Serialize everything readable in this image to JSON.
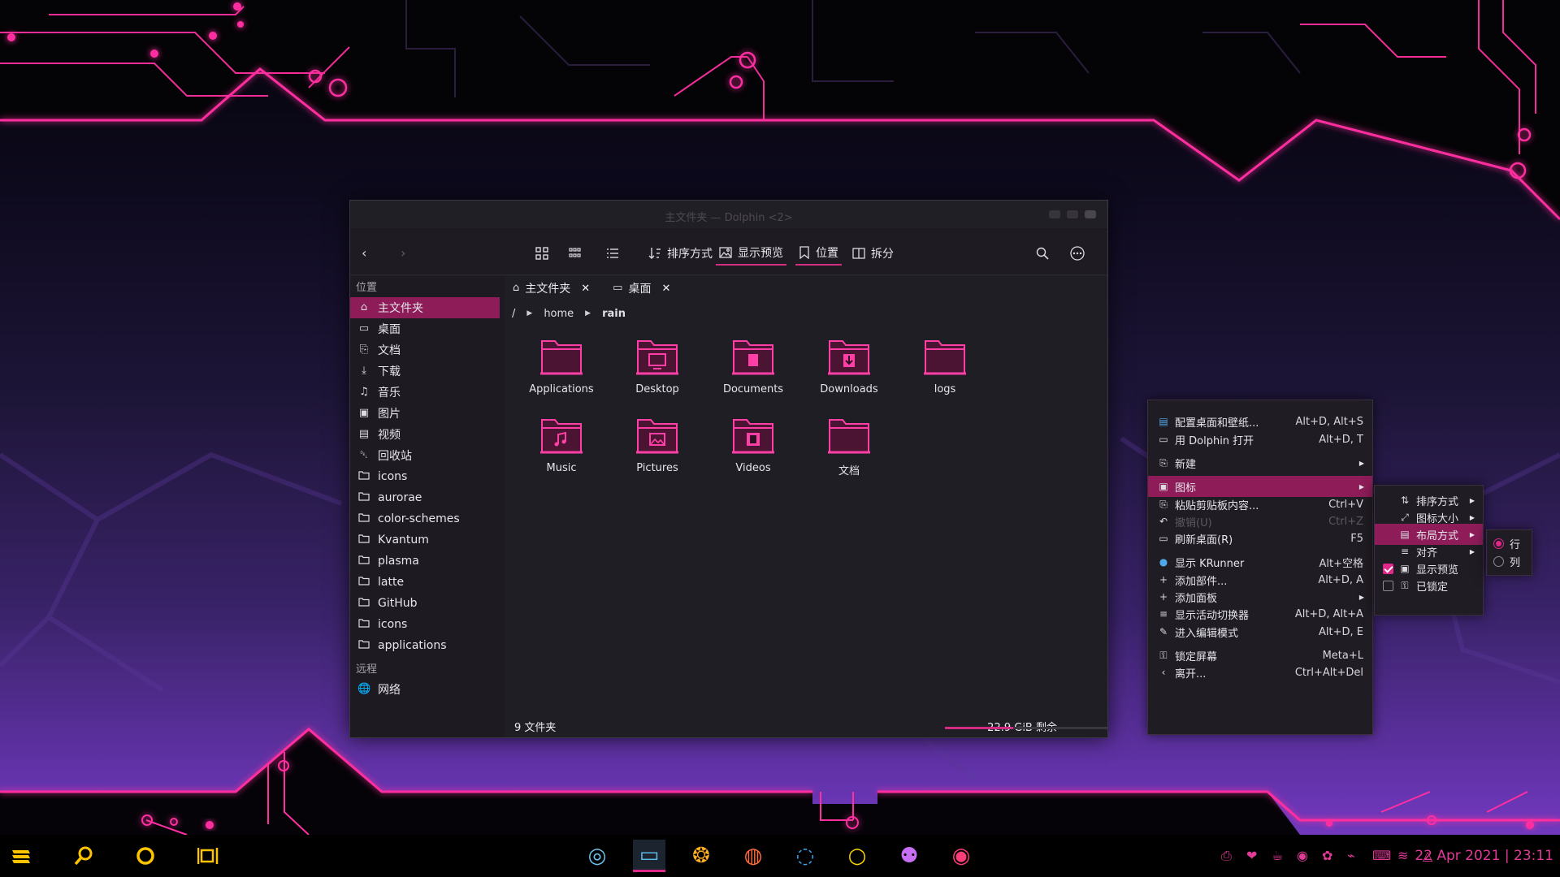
{
  "window": {
    "title": "主文件夹 — Dolphin <2>",
    "toolbar": {
      "sort_label": "排序方式",
      "preview_label": "显示预览",
      "places_label": "位置",
      "split_label": "拆分"
    }
  },
  "sidebar": {
    "places_header": "位置",
    "items": [
      {
        "label": "主文件夹",
        "icon": "home-icon"
      },
      {
        "label": "桌面",
        "icon": "desktop-icon"
      },
      {
        "label": "文档",
        "icon": "document-icon"
      },
      {
        "label": "下载",
        "icon": "download-icon"
      },
      {
        "label": "音乐",
        "icon": "music-icon"
      },
      {
        "label": "图片",
        "icon": "picture-icon"
      },
      {
        "label": "视频",
        "icon": "video-icon"
      },
      {
        "label": "回收站",
        "icon": "trash-icon"
      },
      {
        "label": "icons",
        "icon": "folder-icon"
      },
      {
        "label": "aurorae",
        "icon": "folder-icon"
      },
      {
        "label": "color-schemes",
        "icon": "folder-icon"
      },
      {
        "label": "Kvantum",
        "icon": "folder-icon"
      },
      {
        "label": "plasma",
        "icon": "folder-icon"
      },
      {
        "label": "latte",
        "icon": "folder-icon"
      },
      {
        "label": "GitHub",
        "icon": "folder-icon"
      },
      {
        "label": "icons",
        "icon": "folder-icon"
      },
      {
        "label": "applications",
        "icon": "folder-icon"
      }
    ],
    "remote_header": "远程",
    "remote_items": [
      {
        "label": "网络",
        "icon": "network-icon"
      }
    ]
  },
  "tabs": [
    {
      "label": "主文件夹",
      "icon": "home-icon"
    },
    {
      "label": "桌面",
      "icon": "desktop-icon"
    }
  ],
  "breadcrumb": {
    "root": "/",
    "parts": [
      "home",
      "rain"
    ]
  },
  "files": [
    {
      "label": "Applications",
      "emblem": ""
    },
    {
      "label": "Desktop",
      "emblem": "desktop"
    },
    {
      "label": "Documents",
      "emblem": "doc"
    },
    {
      "label": "Downloads",
      "emblem": "down"
    },
    {
      "label": "logs",
      "emblem": ""
    },
    {
      "label": "Music",
      "emblem": "music"
    },
    {
      "label": "Pictures",
      "emblem": "pic"
    },
    {
      "label": "Videos",
      "emblem": "video"
    },
    {
      "label": "文档",
      "emblem": ""
    }
  ],
  "status": {
    "count": "9 文件夹",
    "free": "22.9 GiB 剩余",
    "used_fraction": 0.42
  },
  "context_menu": {
    "items": [
      {
        "label": "配置桌面和壁纸...",
        "shortcut": "Alt+D, Alt+S"
      },
      {
        "label": "用 Dolphin 打开",
        "shortcut": "Alt+D, T"
      },
      {
        "label": "新建",
        "shortcut": ""
      },
      {
        "label": "图标",
        "shortcut": ""
      },
      {
        "label": "粘贴剪贴板内容...",
        "shortcut": "Ctrl+V"
      },
      {
        "label": "撤销(U)",
        "shortcut": "Ctrl+Z"
      },
      {
        "label": "刷新桌面(R)",
        "shortcut": "F5"
      },
      {
        "label": "显示 KRunner",
        "shortcut": "Alt+空格"
      },
      {
        "label": "添加部件...",
        "shortcut": "Alt+D, A"
      },
      {
        "label": "添加面板",
        "shortcut": ""
      },
      {
        "label": "显示活动切换器",
        "shortcut": "Alt+D, Alt+A"
      },
      {
        "label": "进入编辑模式",
        "shortcut": "Alt+D, E"
      },
      {
        "label": "锁定屏幕",
        "shortcut": "Meta+L"
      },
      {
        "label": "离开...",
        "shortcut": "Ctrl+Alt+Del"
      }
    ]
  },
  "icons_submenu": {
    "items": [
      "排序方式",
      "图标大小",
      "布局方式",
      "对齐",
      "显示预览",
      "已锁定"
    ],
    "preview_checked": true,
    "locked_checked": false
  },
  "layout_submenu": {
    "items": [
      "行",
      "列"
    ],
    "selected": "行"
  },
  "panel": {
    "left_icons": [
      "menu-icon",
      "search-icon",
      "circle-icon",
      "window-switch-icon"
    ],
    "task_icons": [
      "camera-icon",
      "dolphin-icon",
      "anime-icon",
      "firefox-icon",
      "edge-icon",
      "chat-icon",
      "github-icon",
      "cherry-icon"
    ],
    "tray_icons": [
      "printer-icon",
      "bucket-icon",
      "cup-icon",
      "disc-icon",
      "flower-icon",
      "network-icon",
      "keyboard-icon",
      "volume-icon",
      "vpn-icon"
    ],
    "date": "22 Apr 2021",
    "time": "23:11"
  },
  "colors": {
    "accent": "#d32d82",
    "neon": "#ff2fa0",
    "selection": "#8d1c59"
  }
}
